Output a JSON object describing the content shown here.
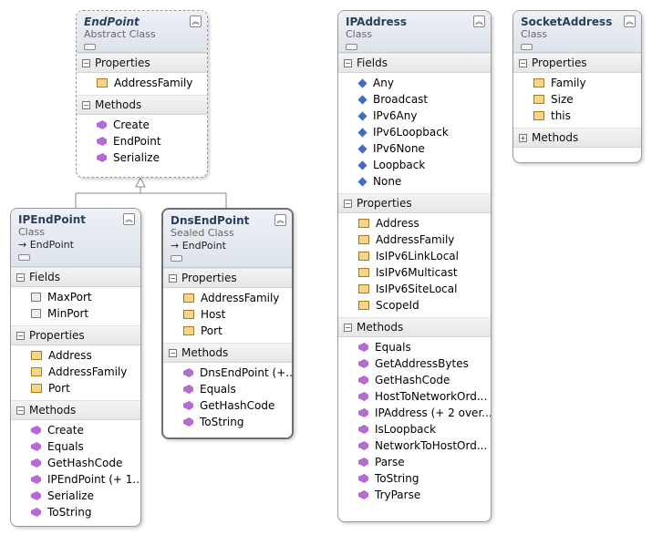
{
  "shapes": {
    "endpoint": {
      "title": "EndPoint",
      "stereotype": "Abstract Class",
      "properties_label": "Properties",
      "properties": [
        "AddressFamily"
      ],
      "methods_label": "Methods",
      "methods": [
        "Create",
        "EndPoint",
        "Serialize"
      ]
    },
    "ipendpoint": {
      "title": "IPEndPoint",
      "stereotype": "Class",
      "base": "→ EndPoint",
      "fields_label": "Fields",
      "fields": [
        "MaxPort",
        "MinPort"
      ],
      "properties_label": "Properties",
      "properties": [
        "Address",
        "AddressFamily",
        "Port"
      ],
      "methods_label": "Methods",
      "methods": [
        "Create",
        "Equals",
        "GetHashCode",
        "IPEndPoint (+ 1...",
        "Serialize",
        "ToString"
      ]
    },
    "dnsendpoint": {
      "title": "DnsEndPoint",
      "stereotype": "Sealed Class",
      "base": "→ EndPoint",
      "properties_label": "Properties",
      "properties": [
        "AddressFamily",
        "Host",
        "Port"
      ],
      "methods_label": "Methods",
      "methods": [
        "DnsEndPoint (+...",
        "Equals",
        "GetHashCode",
        "ToString"
      ]
    },
    "ipaddress": {
      "title": "IPAddress",
      "stereotype": "Class",
      "fields_label": "Fields",
      "fields": [
        "Any",
        "Broadcast",
        "IPv6Any",
        "IPv6Loopback",
        "IPv6None",
        "Loopback",
        "None"
      ],
      "properties_label": "Properties",
      "properties": [
        "Address",
        "AddressFamily",
        "IsIPv6LinkLocal",
        "IsIPv6Multicast",
        "IsIPv6SiteLocal",
        "ScopeId"
      ],
      "methods_label": "Methods",
      "methods": [
        "Equals",
        "GetAddressBytes",
        "GetHashCode",
        "HostToNetworkOrd...",
        "IPAddress (+ 2 over...",
        "IsLoopback",
        "NetworkToHostOrd...",
        "Parse",
        "ToString",
        "TryParse"
      ]
    },
    "socketaddress": {
      "title": "SocketAddress",
      "stereotype": "Class",
      "properties_label": "Properties",
      "properties": [
        "Family",
        "Size",
        "this"
      ],
      "methods_label": "Methods"
    }
  },
  "icons": {
    "collapse": "double-chevron-up-icon",
    "property": "property-icon",
    "field": "field-icon",
    "method": "method-icon",
    "constant": "constant-icon",
    "section_expanded": "minus-box-icon",
    "section_collapsed": "plus-box-icon"
  },
  "colors": {
    "title": "#2e3e5c",
    "header_top": "#eef1f6",
    "header_bottom": "#dde3ec",
    "method_icon": "#b66ad3",
    "field_icon": "#3d6fc4",
    "property_icon": "#f2d68c"
  }
}
